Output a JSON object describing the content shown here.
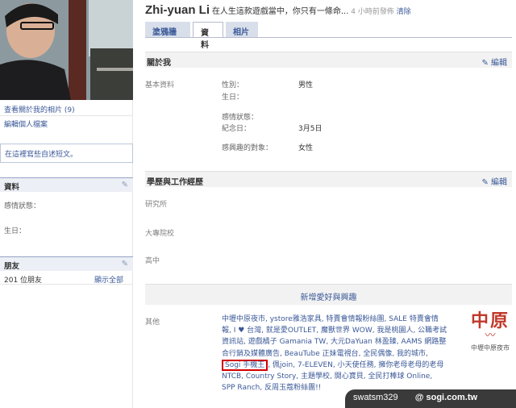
{
  "left": {
    "view_photos": "查看關於我的相片 (9)",
    "edit_profile": "編輯個人檔案",
    "post_placeholder": "在這裡寫些自述短文。",
    "info_box": {
      "title": "資料",
      "relationship": "感情狀態：",
      "birthday": "生日："
    },
    "friends_box": {
      "title": "朋友",
      "count": "201 位朋友",
      "show_all": "顯示全部"
    }
  },
  "header": {
    "name": "Zhi-yuan Li",
    "status": "在人生這款遊戲當中，你只有一條命...",
    "time": "4 小時前發佈",
    "clear": "清除",
    "tabs": [
      "塗鴉牆",
      "資料",
      "相片"
    ]
  },
  "about": {
    "title": "關於我",
    "edit": "編輯",
    "basic_label": "基本資料",
    "fields": {
      "sex_label": "性別：",
      "sex_value": "男性",
      "birthday_label": "生日：",
      "relationship_label": "感情狀態：",
      "anniversary_label": "紀念日：",
      "anniversary_value": "3月5日",
      "interested_label": "感興趣的對象：",
      "interested_value": "女性"
    }
  },
  "edu": {
    "title": "學歷與工作經歷",
    "edit": "編輯",
    "grad": "研究所",
    "college": "大專院校",
    "high": "高中"
  },
  "add_interest": "新增愛好與興趣",
  "other": {
    "label": "其他",
    "text_before": "中壢中原夜市, ystore雅浩家具, 特賣會情報粉絲團, SALE 特賣會情報, I ♥ 台灣, 就是愛OUTLET, 魔獸世界 WOW, 我是桃園人, 公職考試資訊站, 遊戲橘子 Gamania TW, 大元DaYuan 林盈臻, AAMS 網路整合行銷及媒體廣告, BeauTube 正妹電視台, 全民偶像, 我的城市, ",
    "highlight": "Sogi 手機王",
    "text_after": ", 佩join, 7-ELEVEN, 小天使任務, 擁你老母老母的老母NTCB, Country Story, 主題學校, 開心寶貝, 全民打棒球 Online, SPP Ranch, 反周玉蔻粉絲團!!",
    "logo_text": "中原",
    "logo_caption": "中壢中原夜市"
  },
  "watermark": {
    "user": "swatsm329",
    "site": "@ sogi.com.tw"
  }
}
